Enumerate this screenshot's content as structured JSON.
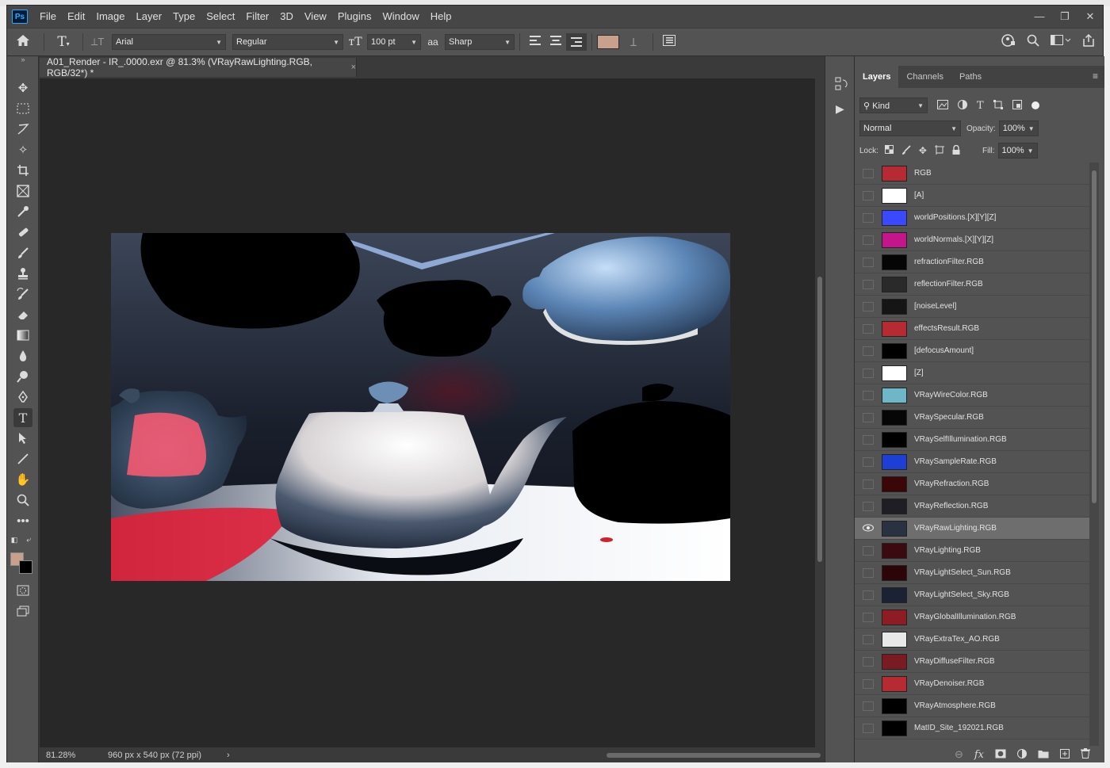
{
  "menubar": {
    "logo": "Ps",
    "items": [
      "File",
      "Edit",
      "Image",
      "Layer",
      "Type",
      "Select",
      "Filter",
      "3D",
      "View",
      "Plugins",
      "Window",
      "Help"
    ],
    "controls": [
      "—",
      "❐",
      "✕"
    ]
  },
  "options": {
    "font_family": "Arial",
    "font_style": "Regular",
    "font_size": "100 pt",
    "antialias_label": "aa",
    "antialias": "Sharp",
    "text_color": "#c9a08c"
  },
  "document": {
    "tab_title": "A01_Render - IR_.0000.exr @ 81.3% (VRayRawLighting.RGB, RGB/32*) *",
    "close": "×",
    "zoom": "81.28%",
    "doc_info": "960 px x 540 px (72 ppi)",
    "status_arrow": "›"
  },
  "colors": {
    "foreground": "#c9a08c",
    "background": "#000000"
  },
  "panel": {
    "tabs": [
      "Layers",
      "Channels",
      "Paths"
    ],
    "filter_kind": "Kind",
    "blend_mode": "Normal",
    "opacity_label": "Opacity:",
    "opacity": "100%",
    "lock_label": "Lock:",
    "fill_label": "Fill:",
    "fill": "100%",
    "layers": [
      {
        "name": "RGB",
        "thumb": "#b52a33",
        "visible": false
      },
      {
        "name": "[A]",
        "thumb": "#ffffff",
        "visible": false
      },
      {
        "name": "worldPositions.[X][Y][Z]",
        "thumb": "#3a48ff",
        "visible": false
      },
      {
        "name": "worldNormals.[X][Y][Z]",
        "thumb": "#c4168a",
        "visible": false
      },
      {
        "name": "refractionFilter.RGB",
        "thumb": "#050505",
        "visible": false
      },
      {
        "name": "reflectionFilter.RGB",
        "thumb": "#2a2a2a",
        "visible": false
      },
      {
        "name": "[noiseLevel]",
        "thumb": "#151515",
        "visible": false
      },
      {
        "name": "effectsResult.RGB",
        "thumb": "#b52a33",
        "visible": false
      },
      {
        "name": "[defocusAmount]",
        "thumb": "#000000",
        "visible": false
      },
      {
        "name": "[Z]",
        "thumb": "#ffffff",
        "visible": false
      },
      {
        "name": "VRayWireColor.RGB",
        "thumb": "#6fb6c8",
        "visible": false
      },
      {
        "name": "VRaySpecular.RGB",
        "thumb": "#060606",
        "visible": false
      },
      {
        "name": "VRaySelfIllumination.RGB",
        "thumb": "#000000",
        "visible": false
      },
      {
        "name": "VRaySampleRate.RGB",
        "thumb": "#1d3fd6",
        "visible": false
      },
      {
        "name": "VRayRefraction.RGB",
        "thumb": "#3a0608",
        "visible": false
      },
      {
        "name": "VRayReflection.RGB",
        "thumb": "#1e1e24",
        "visible": false
      },
      {
        "name": "VRayRawLighting.RGB",
        "thumb": "#2a3140",
        "visible": true
      },
      {
        "name": "VRayLighting.RGB",
        "thumb": "#3a0a10",
        "visible": false
      },
      {
        "name": "VRayLightSelect_Sun.RGB",
        "thumb": "#2b0508",
        "visible": false
      },
      {
        "name": "VRayLightSelect_Sky.RGB",
        "thumb": "#1b2233",
        "visible": false
      },
      {
        "name": "VRayGlobalIllumination.RGB",
        "thumb": "#8e1c24",
        "visible": false
      },
      {
        "name": "VRayExtraTex_AO.RGB",
        "thumb": "#e8e8e8",
        "visible": false
      },
      {
        "name": "VRayDiffuseFilter.RGB",
        "thumb": "#7a1a22",
        "visible": false
      },
      {
        "name": "VRayDenoiser.RGB",
        "thumb": "#b52a33",
        "visible": false
      },
      {
        "name": "VRayAtmosphere.RGB",
        "thumb": "#000000",
        "visible": false
      },
      {
        "name": "MatID_Site_192021.RGB",
        "thumb": "#000000",
        "visible": false
      }
    ]
  },
  "icons": [
    "home-icon",
    "type-tool-icon",
    "vertical-type-icon",
    "font-size-icon",
    "align-left-icon",
    "align-center-icon",
    "align-right-icon",
    "warp-text-icon",
    "character-panel-icon",
    "search-icon",
    "workspace-icon",
    "share-icon",
    "eye-icon"
  ]
}
